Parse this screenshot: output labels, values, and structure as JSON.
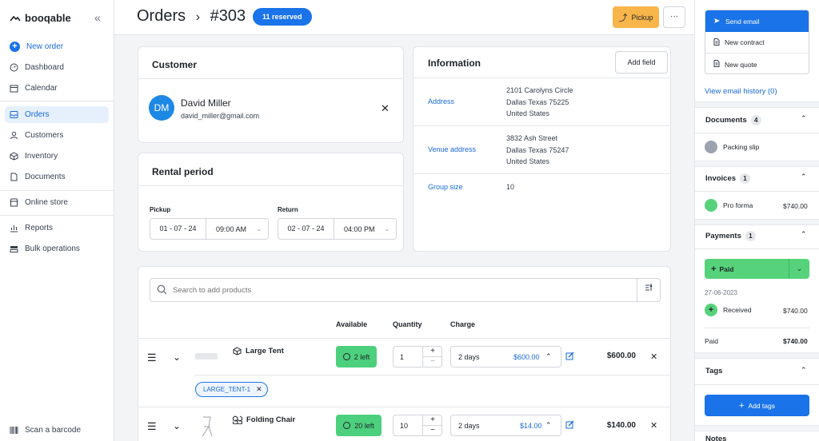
{
  "app": {
    "name": "booqable"
  },
  "sidebar": {
    "items": [
      {
        "label": "New order",
        "icon": "plus-circle-icon"
      },
      {
        "label": "Dashboard",
        "icon": "dashboard-icon"
      },
      {
        "label": "Calendar",
        "icon": "calendar-icon"
      },
      {
        "label": "Orders",
        "icon": "orders-icon"
      },
      {
        "label": "Customers",
        "icon": "customer-icon"
      },
      {
        "label": "Inventory",
        "icon": "box-icon"
      },
      {
        "label": "Documents",
        "icon": "document-icon"
      },
      {
        "label": "Online store",
        "icon": "store-icon"
      },
      {
        "label": "Reports",
        "icon": "reports-icon"
      },
      {
        "label": "Bulk operations",
        "icon": "bulk-icon"
      }
    ],
    "scan": "Scan a barcode"
  },
  "header": {
    "title": "Orders",
    "order_number": "#303",
    "status_badge": "11 reserved",
    "pickup_button": "Pickup",
    "more_button": "···"
  },
  "customer": {
    "title": "Customer",
    "initials": "DM",
    "name": "David Miller",
    "email": "david_miller@gmail.com"
  },
  "rental_period": {
    "title": "Rental period",
    "pickup_label": "Pickup",
    "return_label": "Return",
    "pickup_date": "01 - 07 - 24",
    "pickup_time": "09:00 AM",
    "return_date": "02 - 07 - 24",
    "return_time": "04:00 PM"
  },
  "information": {
    "title": "Information",
    "add_field": "Add field",
    "rows": [
      {
        "label": "Address",
        "lines": [
          "2101 Carolyns Circle",
          "Dallas Texas 75225",
          "United States"
        ]
      },
      {
        "label": "Venue address",
        "lines": [
          "3832 Ash Street",
          "Dallas Texas 75247",
          "United States"
        ]
      },
      {
        "label": "Group size",
        "lines": [
          "10"
        ]
      }
    ]
  },
  "products": {
    "search_placeholder": "Search to add products",
    "columns": {
      "available": "Available",
      "quantity": "Quantity",
      "charge": "Charge"
    },
    "rows": [
      {
        "name": "Large Tent",
        "available": "2 left",
        "quantity": "1",
        "charge_period": "2 days",
        "charge_amount": "$600.00",
        "total": "$600.00",
        "tag": "LARGE_TENT-1"
      },
      {
        "name": "Folding Chair",
        "available": "20 left",
        "quantity": "10",
        "charge_period": "2 days",
        "charge_amount": "$14.00",
        "total": "$140.00"
      }
    ]
  },
  "right_panel": {
    "menu": [
      "Send email",
      "New contract",
      "New quote"
    ],
    "email_history": "View email history (0)",
    "documents": {
      "title": "Documents",
      "count": "4",
      "item": "Packing slip"
    },
    "invoices": {
      "title": "Invoices",
      "count": "1",
      "item": "Pro forma",
      "amount": "$740.00"
    },
    "payments": {
      "title": "Payments",
      "count": "1",
      "paid_button": "Paid",
      "date": "27-06-2023",
      "received_label": "Received",
      "received_amount": "$740.00",
      "paid_label": "Paid",
      "paid_amount": "$740.00"
    },
    "tags": {
      "title": "Tags",
      "add_button": "Add tags"
    },
    "notes": {
      "title": "Notes"
    }
  },
  "colors": {
    "primary": "#1a73e8",
    "pickup": "#f7b54a",
    "available": "#4cd07d",
    "paid": "#56d27a"
  }
}
